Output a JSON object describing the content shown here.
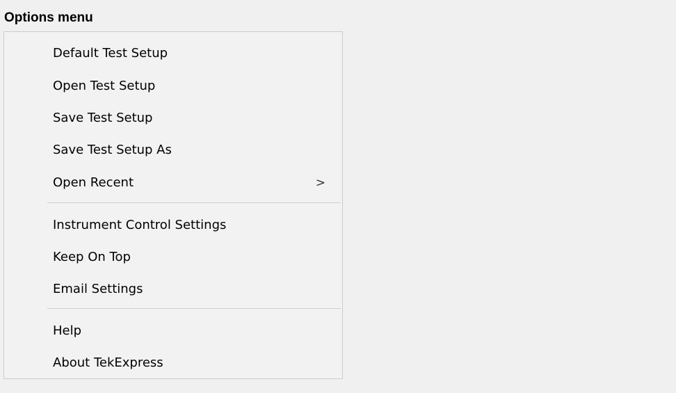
{
  "caption": "Options menu",
  "menu": {
    "items": [
      {
        "label": "Default Test Setup"
      },
      {
        "label": "Open Test Setup"
      },
      {
        "label": "Save Test Setup"
      },
      {
        "label": "Save Test Setup As"
      },
      {
        "label": "Open Recent",
        "submenu_glyph": ">"
      },
      {
        "label": "Instrument Control Settings"
      },
      {
        "label": "Keep On Top"
      },
      {
        "label": "Email Settings"
      },
      {
        "label": "Help"
      },
      {
        "label": "About TekExpress"
      }
    ]
  }
}
